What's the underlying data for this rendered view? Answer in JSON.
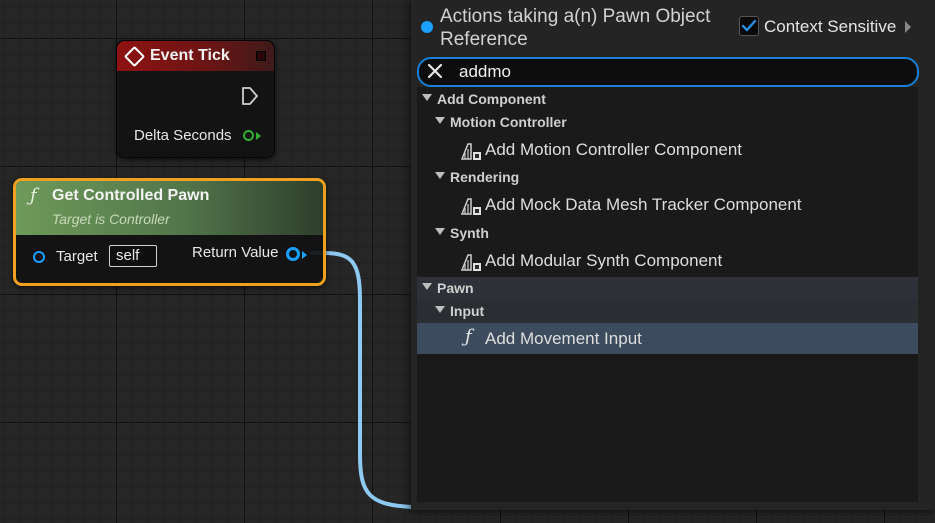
{
  "event_tick": {
    "title": "Event Tick",
    "pin_label": "Delta Seconds"
  },
  "pawn_node": {
    "title": "Get Controlled Pawn",
    "subtitle": "Target is Controller",
    "target_label": "Target",
    "target_value": "self",
    "return_label": "Return Value"
  },
  "menu": {
    "title": "Actions taking a(n) Pawn Object Reference",
    "context_label": "Context Sensitive",
    "context_checked": true,
    "search_value": "addmo",
    "categories": [
      {
        "label": "Add Component",
        "subcategories": [
          {
            "label": "Motion Controller",
            "items": [
              {
                "label": "Add Motion Controller Component",
                "icon": "component-icon"
              }
            ]
          },
          {
            "label": "Rendering",
            "items": [
              {
                "label": "Add Mock Data Mesh Tracker Component",
                "icon": "component-icon"
              }
            ]
          },
          {
            "label": "Synth",
            "items": [
              {
                "label": "Add Modular Synth Component",
                "icon": "component-icon"
              }
            ]
          }
        ]
      },
      {
        "label": "Pawn",
        "subcategories": [
          {
            "label": "Input",
            "items": [
              {
                "label": "Add Movement Input",
                "icon": "function-icon",
                "selected": true
              }
            ]
          }
        ]
      }
    ]
  },
  "colors": {
    "accent": "#1b7fd6",
    "event_header": "#8e1212",
    "function_header": "#6e9a5a",
    "selection_border": "#f0a020",
    "object_pin": "#1aa0ff",
    "float_pin": "#2fae2f",
    "wire": "#8ec9f2",
    "selected_row": "#3c4c5e"
  }
}
